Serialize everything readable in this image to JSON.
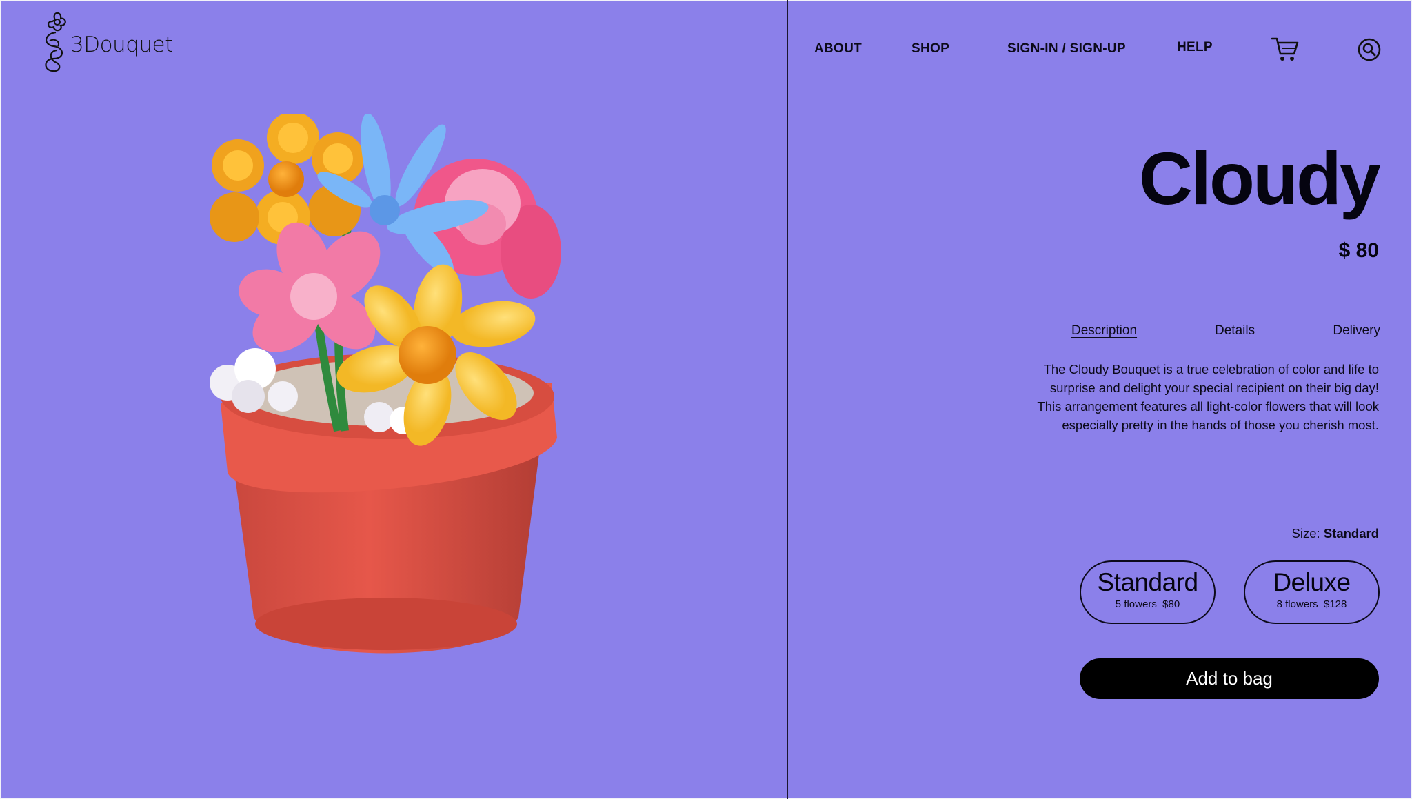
{
  "brand": {
    "name": "3Douquet"
  },
  "nav": {
    "items": [
      {
        "label": "ABOUT"
      },
      {
        "label": "SHOP"
      },
      {
        "label": "SIGN-IN / SIGN-UP"
      },
      {
        "label": "HELP"
      }
    ],
    "cart_icon": "cart-icon",
    "search_icon": "search-icon"
  },
  "product": {
    "title": "Cloudy",
    "price": "$ 80",
    "tabs": [
      {
        "label": "Description",
        "active": true
      },
      {
        "label": "Details",
        "active": false
      },
      {
        "label": "Delivery",
        "active": false
      }
    ],
    "description": "The Cloudy Bouquet is a true celebration of color and life to surprise and delight your special recipient on their big day! This arrangement features all light-color flowers that will look especially pretty in the hands of those you cherish most.",
    "size_label": "Size:",
    "size_value": "Standard",
    "sizes": [
      {
        "name": "Standard",
        "sub": "5 flowers  $80"
      },
      {
        "name": "Deluxe",
        "sub": "8 flowers  $128"
      }
    ],
    "add_button": "Add to bag"
  },
  "colors": {
    "background": "#8b80ea",
    "pot": "#e25447",
    "button": "#000000"
  }
}
